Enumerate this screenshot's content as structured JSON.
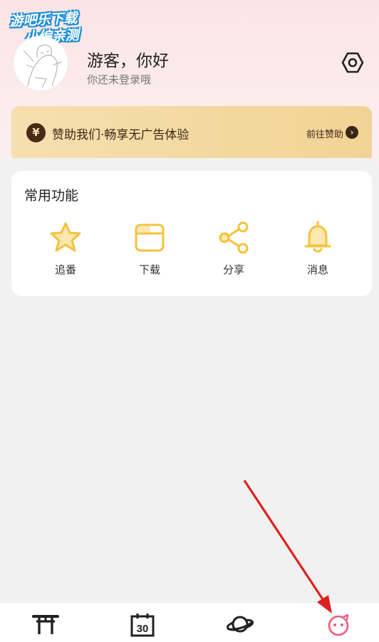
{
  "watermark": {
    "line1": "游吧乐下载",
    "line2": "小编亲测"
  },
  "profile": {
    "greeting": "游客，你好",
    "login_hint": "你还未登录哦",
    "avatar_icon": "avatar-sketch",
    "settings_icon": "settings-hex-icon"
  },
  "vip": {
    "symbol": "¥",
    "text": "赞助我们·畅享无广告体验",
    "link": "前往赞助",
    "arrow": "›"
  },
  "functions": {
    "title": "常用功能",
    "items": [
      {
        "label": "追番",
        "icon": "star-icon"
      },
      {
        "label": "下载",
        "icon": "folder-icon"
      },
      {
        "label": "分享",
        "icon": "share-icon"
      },
      {
        "label": "消息",
        "icon": "bell-icon"
      }
    ]
  },
  "nav": {
    "items": [
      {
        "icon": "torii-icon"
      },
      {
        "icon": "calendar-30-icon",
        "text": "30"
      },
      {
        "icon": "planet-icon"
      },
      {
        "icon": "face-icon",
        "active": true
      }
    ]
  },
  "colors": {
    "accent_yellow": "#f5c23a",
    "nav_active": "#ee5b7d",
    "vip_dark": "#3b2716",
    "annotation_red": "#e02020"
  }
}
